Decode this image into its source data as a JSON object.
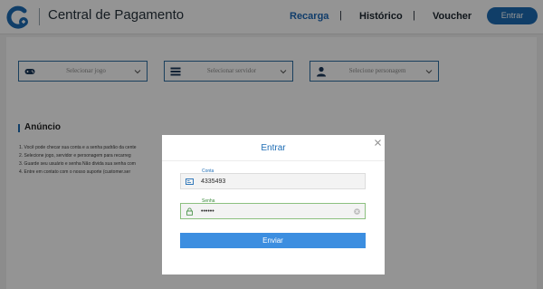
{
  "header": {
    "title": "Central de Pagamento",
    "nav": [
      {
        "label": "Recarga",
        "active": true
      },
      {
        "label": "Histórico",
        "active": false
      },
      {
        "label": "Voucher",
        "active": false
      }
    ],
    "separator": "|",
    "login_button": "Entrar"
  },
  "filters": [
    {
      "icon": "gamepad-icon",
      "placeholder": "Selecionar jogo"
    },
    {
      "icon": "server-list-icon",
      "placeholder": "Selecionar servidor"
    },
    {
      "icon": "user-icon",
      "placeholder": "Selecione personagem"
    }
  ],
  "announcement": {
    "title": "Anúncio",
    "lines": [
      "1. Você pode checar sua conta e a senha padrão da cente",
      "2. Selecione jogo, servidor e personagem para recarreg",
      "3. Guarde seu usuário e senha Não divida sua senha com",
      "4. Entre em contato com o nosso suporte (customer.ser"
    ]
  },
  "modal": {
    "title": "Entrar",
    "account": {
      "label": "Conta",
      "value": "4335493"
    },
    "password": {
      "label": "Senha",
      "value": "••••••"
    },
    "submit_label": "Enviar"
  },
  "colors": {
    "brand": "#1d6cb4",
    "button": "#3c8ee0",
    "active_field_border": "#8cc07f"
  }
}
